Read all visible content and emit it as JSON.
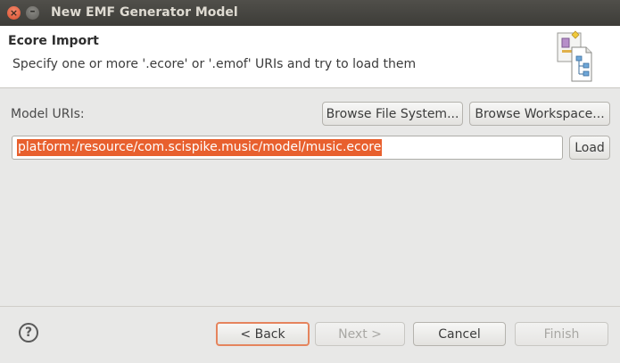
{
  "window": {
    "title": "New EMF Generator Model",
    "close_glyph": "×",
    "minimize_glyph": "–"
  },
  "header": {
    "title": "Ecore Import",
    "description": "Specify one or more '.ecore' or '.emof' URIs and try to load them",
    "icon": "ecore-wizard-icon"
  },
  "form": {
    "model_uris_label": "Model URIs:",
    "browse_file_system": "Browse File System...",
    "browse_workspace": "Browse Workspace...",
    "uri_value": "platform:/resource/com.scispike.music/model/music.ecore",
    "load": "Load"
  },
  "footer": {
    "help_glyph": "?",
    "back": "< Back",
    "next": "Next >",
    "cancel": "Cancel",
    "finish": "Finish"
  },
  "colors": {
    "selection": "#e8602e",
    "default_button_border": "#e5845d",
    "titlebar": "#3d3c38"
  }
}
